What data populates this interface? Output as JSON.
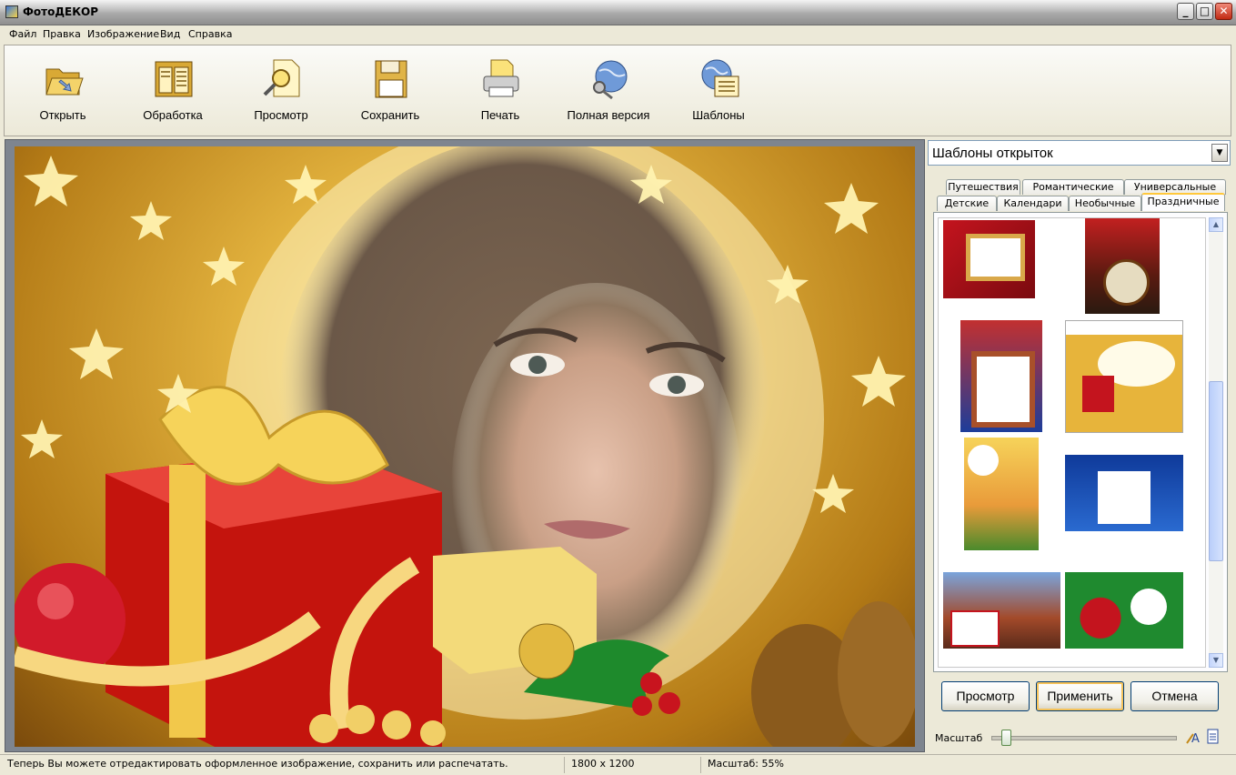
{
  "window": {
    "title": "ФотоДЕКОР",
    "minimize": "_",
    "maximize": "□",
    "close": "✕"
  },
  "menu": [
    "Файл",
    "Правка",
    "Изображение",
    "Вид",
    "Справка"
  ],
  "toolbar": [
    {
      "label": "Открыть",
      "icon": "folder-open-icon"
    },
    {
      "label": "Обработка",
      "icon": "processing-icon"
    },
    {
      "label": "Просмотр",
      "icon": "preview-magnifier-icon"
    },
    {
      "label": "Сохранить",
      "icon": "floppy-disk-icon"
    },
    {
      "label": "Печать",
      "icon": "printer-icon"
    },
    {
      "label": "Полная версия",
      "icon": "globe-key-icon"
    },
    {
      "label": "Шаблоны",
      "icon": "globe-templates-icon"
    }
  ],
  "side": {
    "dropdown": "Шаблоны открыток",
    "tabs_top": [
      "Путешествия",
      "Романтические",
      "Универсальные"
    ],
    "tabs_bottom": [
      "Детские",
      "Календари",
      "Необычные",
      "Праздничные"
    ],
    "active_tab": "Праздничные",
    "buttons": {
      "preview": "Просмотр",
      "apply": "Применить",
      "cancel": "Отмена"
    },
    "zoom_label": "Масштаб",
    "zoom_level": 0.05
  },
  "status": {
    "message": "Теперь Вы можете отредактировать оформленное изображение, сохранить или распечатать.",
    "dimensions": "1800 x 1200",
    "zoom": "Масштаб: 55%"
  },
  "colors": {
    "accent": "#ffc83c",
    "titlebar": "#a9a9a9",
    "face": "#ece9d8"
  }
}
